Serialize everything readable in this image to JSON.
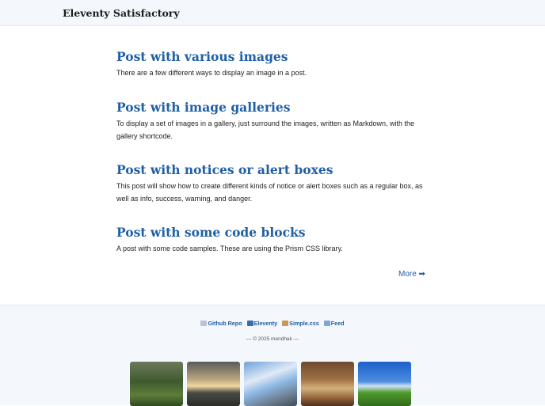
{
  "header": {
    "site_title": "Eleventy Satisfactory"
  },
  "posts": [
    {
      "title": "Post with various images",
      "summary": "There are a few different ways to display an image in a post."
    },
    {
      "title": "Post with image galleries",
      "summary": "To display a set of images in a gallery, just surround the images, written as Markdown, with the gallery shortcode."
    },
    {
      "title": "Post with notices or alert boxes",
      "summary": "This post will show how to create different kinds of notice or alert boxes such as a regular box, as well as info, success, warning, and danger."
    },
    {
      "title": "Post with some code blocks",
      "summary": "A post with some code samples. These are using the Prism CSS library."
    }
  ],
  "more_label": "More ➡",
  "footer": {
    "links": [
      {
        "label": "Github Repo",
        "icon": "github-icon"
      },
      {
        "label": "Eleventy",
        "icon": "eleventy-icon"
      },
      {
        "label": "Simple.css",
        "icon": "simplecss-icon"
      },
      {
        "label": "Feed",
        "icon": "feed-icon"
      }
    ],
    "copyright": "— © 2025 mendhak —",
    "thumbnails": [
      "forest",
      "sunset-sea",
      "mountains-clouds",
      "hall-interior",
      "alpine-village"
    ]
  }
}
